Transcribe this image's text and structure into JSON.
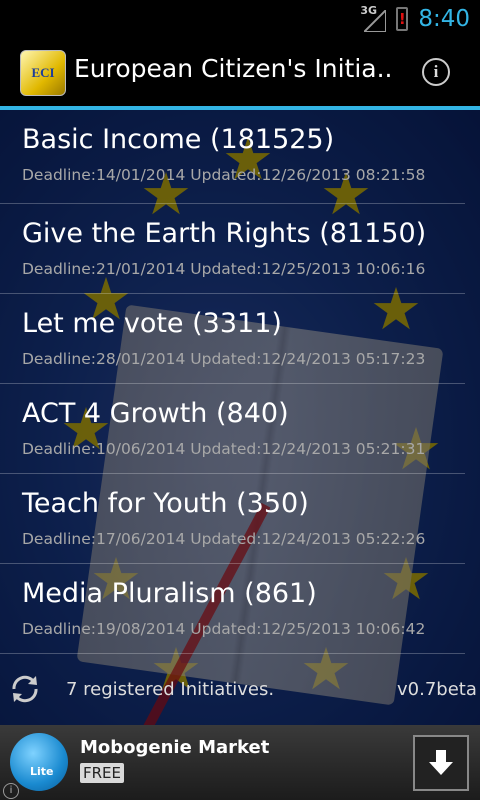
{
  "status_bar": {
    "network": "3G",
    "time": "8:40"
  },
  "action_bar": {
    "app_icon_text": "ECI",
    "title": "European Citizen's Initia...",
    "info_glyph": "i"
  },
  "initiatives": [
    {
      "title": "Basic Income (181525)",
      "meta": "Deadline:14/01/2014 Updated:12/26/2013 08:21:58"
    },
    {
      "title": "Give the Earth Rights (81150)",
      "meta": "Deadline:21/01/2014 Updated:12/25/2013 10:06:16"
    },
    {
      "title": "Let me vote (3311)",
      "meta": "Deadline:28/01/2014 Updated:12/24/2013 05:17:23"
    },
    {
      "title": "ACT 4 Growth (840)",
      "meta": "Deadline:10/06/2014 Updated:12/24/2013 05:21:31"
    },
    {
      "title": "Teach for Youth (350)",
      "meta": "Deadline:17/06/2014 Updated:12/24/2013 05:22:26"
    },
    {
      "title": "Media Pluralism (861)",
      "meta": "Deadline:19/08/2014 Updated:12/25/2013 10:06:42"
    }
  ],
  "footer": {
    "count_text": "7 registered Initiatives.",
    "version": "v0.7beta"
  },
  "ad": {
    "title": "Mobogenie Market",
    "tag": "FREE",
    "logo_text": "Lite",
    "info_glyph": "i"
  },
  "colors": {
    "accent": "#33b5e5",
    "battery_warning": "#e01010"
  },
  "icons": {
    "refresh": "refresh-icon",
    "download": "download-arrow-icon",
    "info": "info-icon"
  }
}
